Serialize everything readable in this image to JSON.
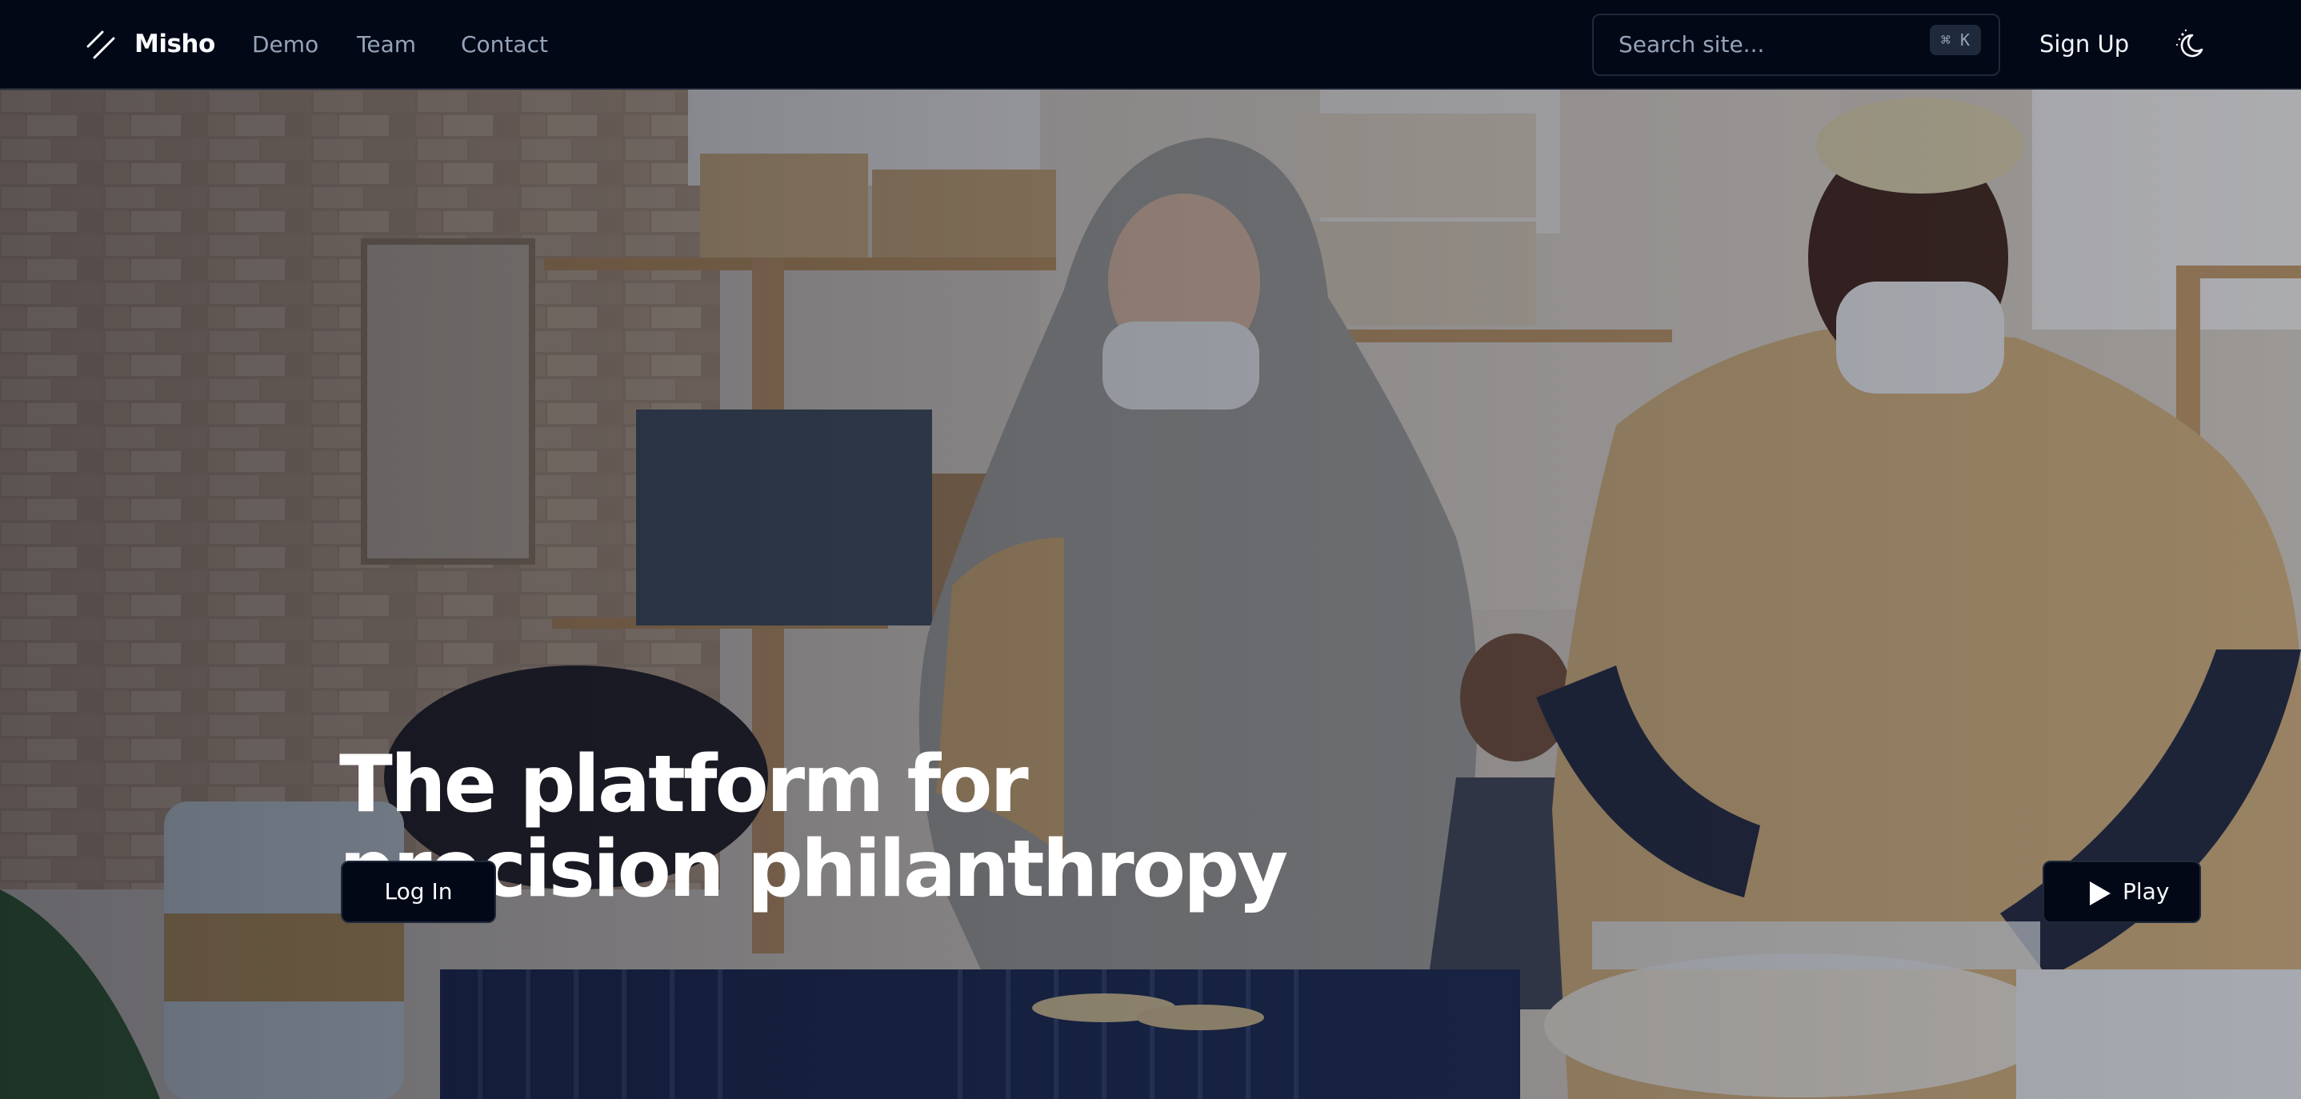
{
  "nav": {
    "logo_icon": "slash-logo-icon",
    "brand": "Misho",
    "links": [
      "Demo",
      "Team",
      "Contact"
    ],
    "search": {
      "placeholder": "Search site...",
      "shortcut": "⌘ K",
      "icon": "command-icon"
    },
    "signup_label": "Sign Up",
    "theme_icon": "moon-stars-icon"
  },
  "hero": {
    "title_line1": "The platform for",
    "title_line2": "precision philanthropy",
    "login_label": "Log In",
    "play_label": "Play",
    "play_icon": "play-icon",
    "background": "photo of masked volunteers packing food donations in a warehouse"
  },
  "colors": {
    "nav_bg": "#030817",
    "button_bg": "#030817",
    "muted_text": "#94a3b8",
    "text": "#f8fafc"
  }
}
